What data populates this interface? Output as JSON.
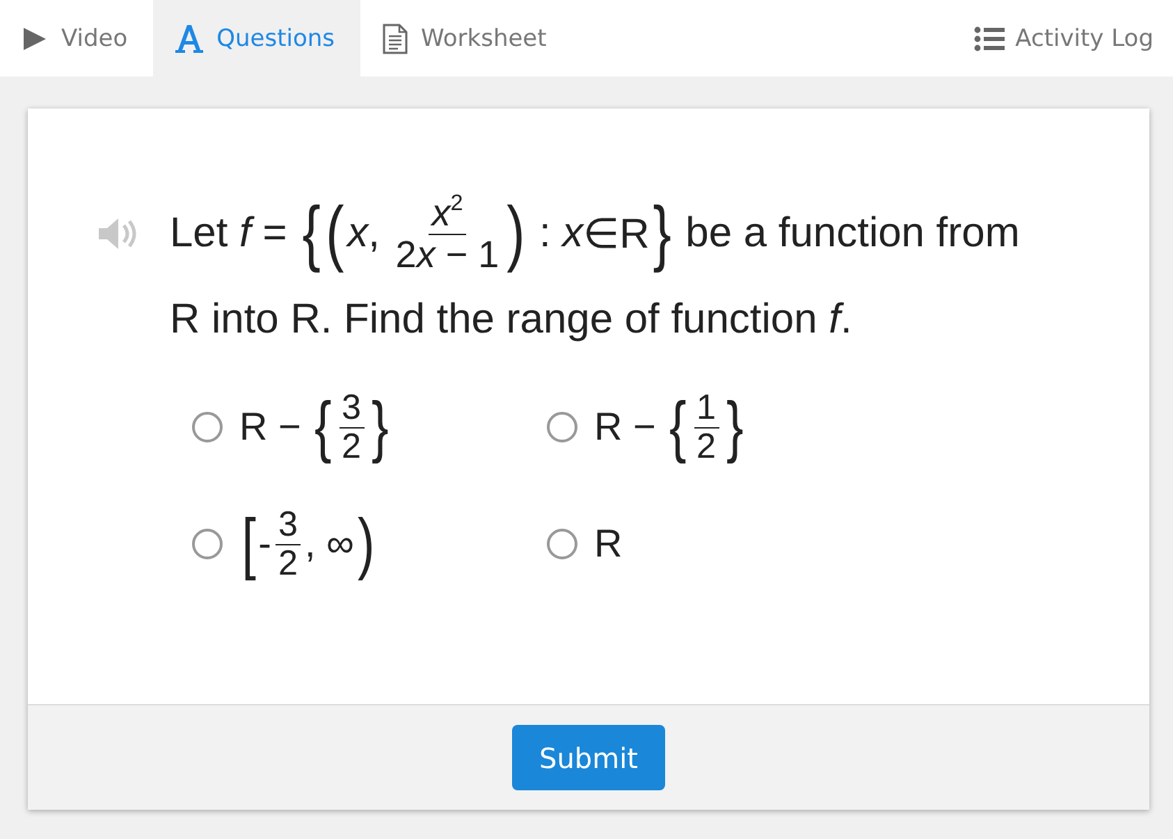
{
  "tabs": [
    {
      "label": "Video",
      "kind": "play",
      "selected": false
    },
    {
      "label": "Questions",
      "kind": "font",
      "selected": true
    },
    {
      "label": "Worksheet",
      "kind": "document",
      "selected": false
    }
  ],
  "activity_log": {
    "label": "Activity Log"
  },
  "question": {
    "lines": [
      [
        {
          "kind": "text",
          "text": "Let "
        },
        {
          "kind": "var",
          "text": "f"
        },
        {
          "kind": "text",
          "text": " = "
        },
        {
          "kind": "big",
          "text": "{"
        },
        {
          "kind": "big",
          "text": "("
        },
        {
          "kind": "var",
          "text": "x"
        },
        {
          "kind": "text",
          "text": ", "
        },
        {
          "kind": "frac",
          "num": [
            {
              "kind": "var",
              "text": "x"
            },
            {
              "kind": "sup",
              "text": "2"
            }
          ],
          "den": [
            {
              "kind": "text",
              "text": "2"
            },
            {
              "kind": "var",
              "text": "x"
            },
            {
              "kind": "text",
              "text": " − 1"
            }
          ]
        },
        {
          "kind": "big",
          "text": ")"
        },
        {
          "kind": "text",
          "text": " : "
        },
        {
          "kind": "var",
          "text": "x"
        },
        {
          "kind": "text",
          "text": "∈R"
        },
        {
          "kind": "big",
          "text": "}"
        },
        {
          "kind": "text",
          "text": " be a function from"
        }
      ],
      [
        {
          "kind": "text",
          "text": "R into R. Find the range of function "
        },
        {
          "kind": "var",
          "text": "f"
        },
        {
          "kind": "text",
          "text": "."
        }
      ]
    ]
  },
  "options": [
    {
      "selected": false,
      "parts": [
        {
          "kind": "text",
          "text": "R − "
        },
        {
          "kind": "big",
          "text": "{"
        },
        {
          "kind": "frac",
          "num": [
            {
              "kind": "text",
              "text": "3"
            }
          ],
          "den": [
            {
              "kind": "text",
              "text": "2"
            }
          ]
        },
        {
          "kind": "big",
          "text": "}"
        }
      ]
    },
    {
      "selected": false,
      "parts": [
        {
          "kind": "text",
          "text": "R − "
        },
        {
          "kind": "big",
          "text": "{"
        },
        {
          "kind": "frac",
          "num": [
            {
              "kind": "text",
              "text": "1"
            }
          ],
          "den": [
            {
              "kind": "text",
              "text": "2"
            }
          ]
        },
        {
          "kind": "big",
          "text": "}"
        }
      ]
    },
    {
      "selected": false,
      "parts": [
        {
          "kind": "big",
          "text": "["
        },
        {
          "kind": "text",
          "text": "-"
        },
        {
          "kind": "frac",
          "num": [
            {
              "kind": "text",
              "text": "3"
            }
          ],
          "den": [
            {
              "kind": "text",
              "text": "2"
            }
          ]
        },
        {
          "kind": "text",
          "text": ", ∞"
        },
        {
          "kind": "big",
          "text": ")"
        }
      ]
    },
    {
      "selected": false,
      "parts": [
        {
          "kind": "text",
          "text": "R"
        }
      ]
    }
  ],
  "submit": {
    "label": "Submit"
  }
}
